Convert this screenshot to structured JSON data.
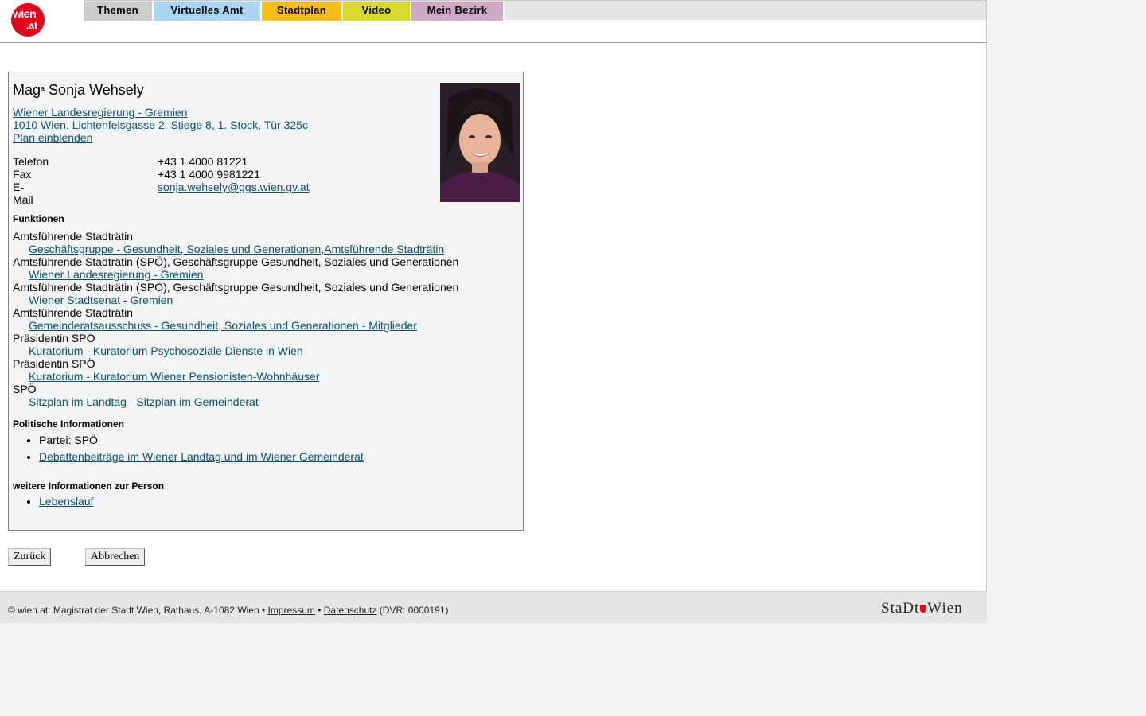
{
  "logo": {
    "line1": "wien",
    "line2": ".at"
  },
  "nav": {
    "tabs": [
      {
        "label": "Themen",
        "color": "#cccccc"
      },
      {
        "label": "Virtuelles Amt",
        "color": "#a8d6f2"
      },
      {
        "label": "Stadtplan",
        "color": "#f8be16"
      },
      {
        "label": "Video",
        "color": "#d7d92c"
      },
      {
        "label": "Mein Bezirk",
        "color": "#cfa9c6"
      }
    ]
  },
  "person": {
    "title_prefix": "Mag",
    "title_suffix": "a",
    "name": "Sonja Wehsely",
    "org_link": "Wiener Landesregierung - Gremien ",
    "address_link": "1010 Wien, Lichtenfelsgasse 2, Stiege 8, 1. Stock, Tür 325c",
    "plan_link": "Plan einblenden",
    "contact": {
      "phone_label": "Telefon",
      "phone": "+43 1 4000 81221",
      "fax_label": "Fax",
      "fax": "+43 1 4000 9981221",
      "email_label": "E-Mail",
      "email": "sonja.wehsely@ggs.wien.gv.at"
    }
  },
  "functions": {
    "heading": "Funktionen",
    "items": [
      {
        "title": "Amtsführende Stadträtin",
        "link": "Geschäftsgruppe - Gesundheit, Soziales und Generationen,Amtsführende Stadträtin"
      },
      {
        "title": "Amtsführende Stadträtin (SPÖ), Geschäftsgruppe Gesundheit, Soziales und Generationen",
        "link": "Wiener Landesregierung - Gremien"
      },
      {
        "title": "Amtsführende Stadträtin (SPÖ), Geschäftsgruppe Gesundheit, Soziales und Generationen",
        "link": "Wiener Stadtsenat - Gremien"
      },
      {
        "title": "Amtsführende Stadträtin",
        "link": "Gemeinderatsausschuss - Gesundheit, Soziales und Generationen - Mitglieder"
      },
      {
        "title": "Präsidentin SPÖ",
        "link": "Kuratorium - Kuratorium Psychosoziale Dienste in Wien"
      },
      {
        "title": "Präsidentin SPÖ",
        "link": "Kuratorium - Kuratorium Wiener Pensionisten-Wohnhäuser"
      }
    ],
    "party": "SPÖ",
    "seat_link_1": "Sitzplan im Landtag",
    "seat_separator": " - ",
    "seat_link_2": "Sitzplan im Gemeinderat"
  },
  "political": {
    "heading": "Politische Informationen",
    "party_text": "Partei: SPÖ",
    "debates_link": "Debattenbeiträge im Wiener Landtag und im Wiener Gemeinderat"
  },
  "more": {
    "heading": "weitere Informationen zur Person",
    "cv_link": "Lebenslauf"
  },
  "buttons": {
    "back": "Zurück",
    "cancel": "Abbrechen"
  },
  "footer": {
    "text": "© wien.at: Magistrat der Stadt Wien, Rathaus, A-1082 Wien • ",
    "impressum": "Impressum",
    "sep": " • ",
    "datenschutz": "Datenschutz",
    "dvr": " (DVR: 0000191)",
    "brand_left": "StaDt",
    "brand_right": "Wien"
  }
}
